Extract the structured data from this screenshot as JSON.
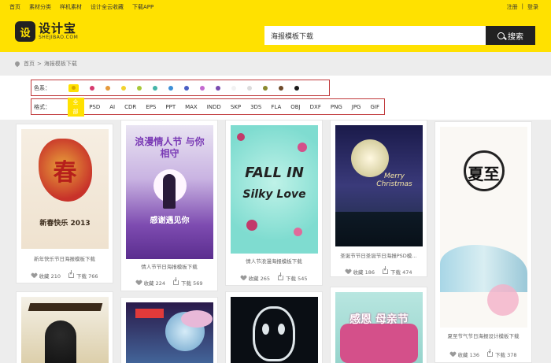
{
  "header": {
    "nav": [
      "首页",
      "素材分类",
      "样机素材",
      "设计全云收藏",
      "下载APP"
    ],
    "user_links": [
      "注册",
      "|",
      "登录"
    ],
    "logo_mark": "设",
    "logo_cn": "设计宝",
    "logo_en": "SHEJIBAO.COM",
    "search_value": "海报模板下载",
    "search_button": "搜索"
  },
  "breadcrumb": [
    "首页",
    ">",
    "海报模板下载"
  ],
  "filters": {
    "color_label": "色系：",
    "colors": [
      "#ffe100",
      "#d63a6e",
      "#e59a3c",
      "#f2d22e",
      "#a8c83a",
      "#45b5a8",
      "#3c8fd6",
      "#4a5fc4",
      "#c46ad0",
      "#7a4bb0",
      "#f2f2f2",
      "#dcdcdc",
      "#8a8a2e",
      "#6e4a2a",
      "#1a1a1a"
    ],
    "format_label": "格式：",
    "formats": [
      "全部",
      "PSD",
      "AI",
      "CDR",
      "EPS",
      "PPT",
      "MAX",
      "INDD",
      "SKP",
      "3DS",
      "FLA",
      "OBJ",
      "DXF",
      "PNG",
      "JPG",
      "GIF"
    ],
    "active_format": "全部"
  },
  "cards": [
    {
      "title": "新年快乐节日海报模板下载",
      "favorites": "收藏 210",
      "downloads": "下载 766",
      "poster_text": "春",
      "sub_text": "新春快乐 2013"
    },
    {
      "title": "情人节节日海报模板下载",
      "favorites": "收藏 224",
      "downloads": "下载 569",
      "poster_text": "浪漫情人节 与你相守",
      "sub_text": "感谢遇见你"
    },
    {
      "title": "情人节浪漫海报模板下载",
      "favorites": "收藏 265",
      "downloads": "下载 545",
      "poster_text": "FALL IN",
      "sub_text": "Silky Love"
    },
    {
      "title": "圣诞节节日圣诞节日海报PSD模…",
      "favorites": "收藏 186",
      "downloads": "下载 474",
      "poster_text": "Merry Christmas",
      "sub_text": ""
    },
    {
      "title": "夏至节气节日海报设计模板下载",
      "favorites": "收藏 136",
      "downloads": "下载 378",
      "poster_text": "夏至",
      "sub_text": ""
    },
    {
      "title": "",
      "favorites": "",
      "downloads": "",
      "poster_text": "",
      "sub_text": ""
    },
    {
      "title": "",
      "favorites": "",
      "downloads": "",
      "poster_text": "",
      "sub_text": ""
    },
    {
      "title": "",
      "favorites": "",
      "downloads": "",
      "poster_text": "",
      "sub_text": ""
    },
    {
      "title": "",
      "favorites": "",
      "downloads": "",
      "poster_text": "感恩 母亲节",
      "sub_text": ""
    }
  ]
}
